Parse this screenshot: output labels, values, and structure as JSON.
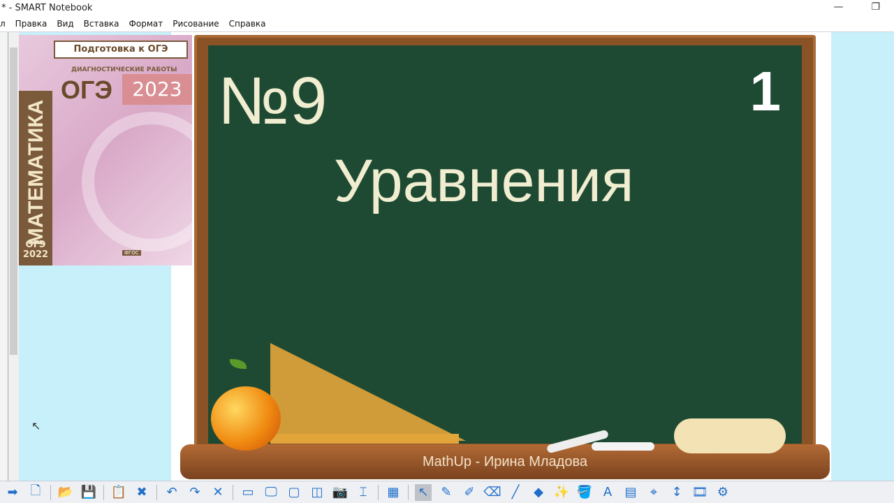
{
  "window": {
    "title": "* - SMART Notebook",
    "controls": [
      "—",
      "❐"
    ]
  },
  "menu": [
    "л",
    "Правка",
    "Вид",
    "Вставка",
    "Формат",
    "Рисование",
    "Справка"
  ],
  "book": {
    "series": "Подготовка к ОГЭ",
    "subtitle": "ДИАГНОСТИЧЕСКИЕ РАБОТЫ",
    "exam": "ОГЭ",
    "year": "2023",
    "spine": "МАТЕМАТИКА",
    "spine_exam": "ОГЭ",
    "spine_year": "2022",
    "badge": "ФГОС"
  },
  "slide": {
    "number": "№9",
    "page": "1",
    "heading": "Уравнения",
    "credit": "MathUp - Ирина Младова"
  },
  "toolbar": [
    {
      "name": "next-page",
      "glyph": "➡"
    },
    {
      "name": "add-page",
      "glyph": "🗋"
    },
    {
      "sep": true
    },
    {
      "name": "open",
      "glyph": "📂"
    },
    {
      "name": "save",
      "glyph": "💾"
    },
    {
      "sep": true
    },
    {
      "name": "paste",
      "glyph": "📋"
    },
    {
      "name": "delete-page",
      "glyph": "✖"
    },
    {
      "sep": true
    },
    {
      "name": "undo",
      "glyph": "↶"
    },
    {
      "name": "redo",
      "glyph": "↷"
    },
    {
      "name": "delete",
      "glyph": "✕"
    },
    {
      "sep": true
    },
    {
      "name": "screen-shade",
      "glyph": "▭"
    },
    {
      "name": "full-screen",
      "glyph": "🖵"
    },
    {
      "name": "transparent-bg",
      "glyph": "▢"
    },
    {
      "name": "dual-page",
      "glyph": "◫"
    },
    {
      "name": "screen-capture",
      "glyph": "📷"
    },
    {
      "name": "document-camera",
      "glyph": "⌶"
    },
    {
      "sep": true
    },
    {
      "name": "table",
      "glyph": "▦"
    },
    {
      "sep": true
    },
    {
      "name": "select",
      "glyph": "↖",
      "selected": true
    },
    {
      "name": "pen",
      "glyph": "✎"
    },
    {
      "name": "creative-pen",
      "glyph": "✐"
    },
    {
      "name": "eraser",
      "glyph": "⌫"
    },
    {
      "name": "line",
      "glyph": "╱"
    },
    {
      "name": "shapes",
      "glyph": "◆"
    },
    {
      "name": "magic-pen",
      "glyph": "✨"
    },
    {
      "name": "fill",
      "glyph": "🪣"
    },
    {
      "name": "text",
      "glyph": "A"
    },
    {
      "name": "properties",
      "glyph": "▤"
    },
    {
      "name": "measurement",
      "glyph": "⌖"
    },
    {
      "name": "move-toolbar",
      "glyph": "↕"
    },
    {
      "name": "video",
      "glyph": "🎞"
    },
    {
      "name": "more",
      "glyph": "⚙"
    }
  ]
}
